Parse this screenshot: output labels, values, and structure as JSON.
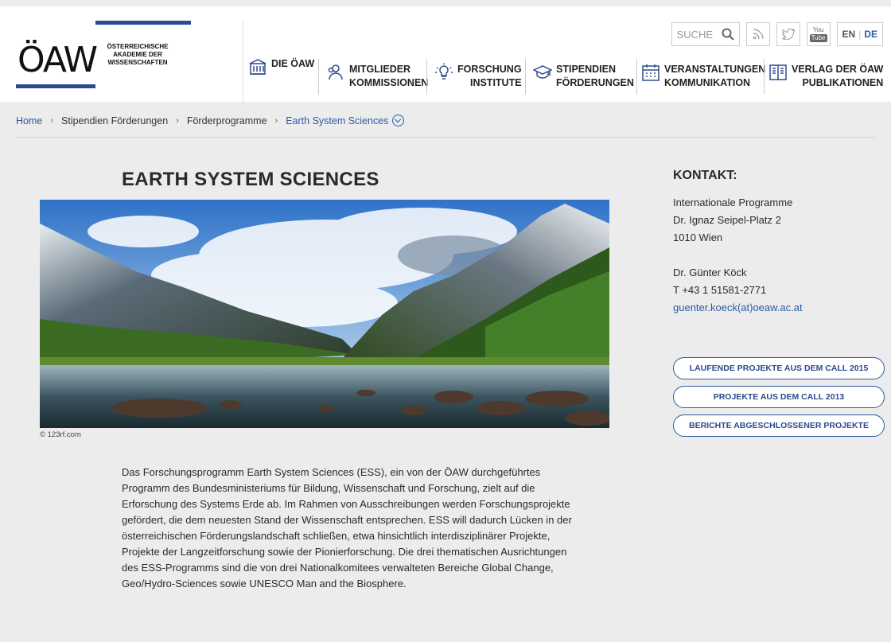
{
  "logo": {
    "abbrev": "ÖAW",
    "line1": "ÖSTERREICHISCHE",
    "line2": "AKADEMIE DER",
    "line3": "WISSENSCHAFTEN"
  },
  "nav": [
    {
      "line1": "DIE ÖAW",
      "line2": "",
      "icon": "building-icon"
    },
    {
      "line1": "MITGLIEDER",
      "line2": "KOMMISSIONEN",
      "icon": "people-icon"
    },
    {
      "line1": "FORSCHUNG",
      "line2": "INSTITUTE",
      "icon": "lightbulb-icon"
    },
    {
      "line1": "STIPENDIEN",
      "line2": "FÖRDERUNGEN",
      "icon": "graduation-cap-icon"
    },
    {
      "line1": "VERANSTALTUNGEN",
      "line2": "KOMMUNIKATION",
      "icon": "calendar-icon"
    },
    {
      "line1": "VERLAG DER ÖAW",
      "line2": "PUBLIKATIONEN",
      "icon": "book-icon"
    }
  ],
  "utils": {
    "search_label": "SUCHE",
    "lang_en": "EN",
    "lang_de": "DE",
    "youtube_top": "You",
    "youtube_bottom": "Tube"
  },
  "breadcrumb": {
    "home": "Home",
    "item1": "Stipendien Förderungen",
    "item2": "Förderprogramme",
    "current": "Earth System Sciences"
  },
  "page": {
    "title": "EARTH SYSTEM SCIENCES",
    "image_credit": "© 123rf.com",
    "body": "Das Forschungsprogramm Earth System Sciences (ESS), ein von der ÖAW durchgeführtes Programm des Bundesministeriums für Bildung, Wissenschaft und Forschung, zielt auf die Erforschung des Systems Erde ab. Im Rahmen von Ausschreibungen werden Forschungsprojekte gefördert, die dem neuesten Stand der Wissenschaft entsprechen. ESS will dadurch Lücken in der österreichischen Förderungslandschaft schließen, etwa hinsichtlich interdisziplinärer Projekte, Projekte der Langzeitforschung sowie der Pionierforschung. Die drei thematischen Ausrichtungen des ESS-Programms sind die von drei Nationalkomitees verwalteten Bereiche Global Change, Geo/Hydro-Sciences sowie UNESCO Man and the Biosphere."
  },
  "kontakt": {
    "title": "KONTAKT:",
    "org": "Internationale Programme",
    "street": "Dr. Ignaz Seipel-Platz 2",
    "city": "1010 Wien",
    "person": "Dr. Günter Köck",
    "phone": "T +43 1 51581-2771",
    "email": "guenter.koeck(at)oeaw.ac.at"
  },
  "buttons": [
    "LAUFENDE PROJEKTE AUS DEM CALL 2015",
    "PROJEKTE AUS DEM CALL 2013",
    "BERICHTE ABGESCHLOSSENER PROJEKTE"
  ],
  "colors": {
    "brand_blue": "#2b4b8f",
    "link_blue": "#2b5aa0",
    "background": "#ececec"
  }
}
